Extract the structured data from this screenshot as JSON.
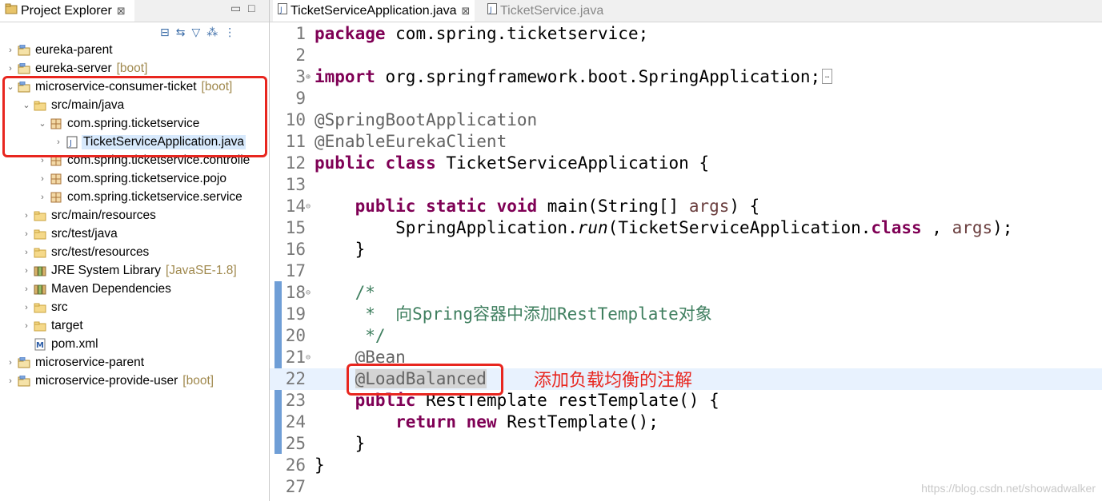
{
  "explorer": {
    "tab_label": "Project Explorer",
    "close_glyph": "⊠",
    "minimize_glyph": "▭",
    "maximize_glyph": "□",
    "toolbar_icons": [
      "collapse-all-icon",
      "link-with-editor-icon",
      "filter-icon",
      "focus-icon",
      "view-menu-icon"
    ],
    "toolbar_glyphs": [
      "⊟",
      "⇆",
      "▽",
      "⁂",
      "⋮"
    ],
    "tree": [
      {
        "indent": 0,
        "twisty": "›",
        "icon": "project-icon",
        "glyph": "📁",
        "label": "eureka-parent",
        "deco": ""
      },
      {
        "indent": 0,
        "twisty": "›",
        "icon": "maven-project-icon",
        "glyph": "📁",
        "label": "eureka-server",
        "deco": "[boot]"
      },
      {
        "indent": 0,
        "twisty": "⌄",
        "icon": "maven-project-icon",
        "glyph": "📁",
        "label": "microservice-consumer-ticket",
        "deco": "[boot]"
      },
      {
        "indent": 1,
        "twisty": "⌄",
        "icon": "source-folder-icon",
        "glyph": "📂",
        "label": "src/main/java",
        "deco": ""
      },
      {
        "indent": 2,
        "twisty": "⌄",
        "icon": "package-icon",
        "glyph": "▦",
        "label": "com.spring.ticketservice",
        "deco": ""
      },
      {
        "indent": 3,
        "twisty": "›",
        "icon": "java-file-icon",
        "glyph": "J",
        "label": "TicketServiceApplication.java",
        "deco": "",
        "selected": true
      },
      {
        "indent": 2,
        "twisty": "›",
        "icon": "package-icon",
        "glyph": "▦",
        "label": "com.spring.ticketservice.controlle",
        "deco": ""
      },
      {
        "indent": 2,
        "twisty": "›",
        "icon": "package-icon",
        "glyph": "▦",
        "label": "com.spring.ticketservice.pojo",
        "deco": ""
      },
      {
        "indent": 2,
        "twisty": "›",
        "icon": "package-icon",
        "glyph": "▦",
        "label": "com.spring.ticketservice.service",
        "deco": ""
      },
      {
        "indent": 1,
        "twisty": "›",
        "icon": "source-folder-icon",
        "glyph": "📂",
        "label": "src/main/resources",
        "deco": ""
      },
      {
        "indent": 1,
        "twisty": "›",
        "icon": "source-folder-icon",
        "glyph": "📂",
        "label": "src/test/java",
        "deco": ""
      },
      {
        "indent": 1,
        "twisty": "›",
        "icon": "source-folder-icon",
        "glyph": "📂",
        "label": "src/test/resources",
        "deco": ""
      },
      {
        "indent": 1,
        "twisty": "›",
        "icon": "library-icon",
        "glyph": "▤",
        "label": "JRE System Library",
        "deco": "[JavaSE-1.8]"
      },
      {
        "indent": 1,
        "twisty": "›",
        "icon": "library-icon",
        "glyph": "▤",
        "label": "Maven Dependencies",
        "deco": ""
      },
      {
        "indent": 1,
        "twisty": "›",
        "icon": "folder-icon",
        "glyph": "📂",
        "label": "src",
        "deco": ""
      },
      {
        "indent": 1,
        "twisty": "›",
        "icon": "folder-icon",
        "glyph": "📂",
        "label": "target",
        "deco": ""
      },
      {
        "indent": 1,
        "twisty": "",
        "icon": "maven-pom-icon",
        "glyph": "M",
        "label": "pom.xml",
        "deco": ""
      },
      {
        "indent": 0,
        "twisty": "›",
        "icon": "project-icon",
        "glyph": "📁",
        "label": "microservice-parent",
        "deco": ""
      },
      {
        "indent": 0,
        "twisty": "›",
        "icon": "maven-project-icon",
        "glyph": "📁",
        "label": "microservice-provide-user",
        "deco": "[boot]"
      }
    ]
  },
  "editor": {
    "tabs": [
      {
        "label": "TicketServiceApplication.java",
        "active": true,
        "close": "⊠"
      },
      {
        "label": "TicketService.java",
        "active": false,
        "close": ""
      }
    ],
    "lines": [
      {
        "n": "1",
        "fold": "",
        "tokens": [
          [
            "kw",
            "package"
          ],
          [
            "",
            "com.spring.ticketservice;"
          ]
        ]
      },
      {
        "n": "2",
        "fold": "",
        "tokens": []
      },
      {
        "n": "3",
        "fold": "⊕",
        "tokens": [
          [
            "kw",
            "import"
          ],
          [
            "",
            "org.springframework.boot.SpringApplication;"
          ],
          [
            "box",
            ""
          ]
        ]
      },
      {
        "n": "9",
        "fold": "",
        "tokens": []
      },
      {
        "n": "10",
        "fold": "",
        "tokens": [
          [
            "ann",
            "@SpringBootApplication"
          ]
        ]
      },
      {
        "n": "11",
        "fold": "",
        "tokens": [
          [
            "ann",
            "@EnableEurekaClient"
          ]
        ]
      },
      {
        "n": "12",
        "fold": "",
        "tokens": [
          [
            "kw",
            "public class"
          ],
          [
            "",
            "TicketServiceApplication {"
          ]
        ]
      },
      {
        "n": "13",
        "fold": "",
        "tokens": []
      },
      {
        "n": "14",
        "fold": "⊖",
        "tokens": [
          [
            "",
            "    "
          ],
          [
            "kw",
            "public static void"
          ],
          [
            "",
            " main(String[] "
          ],
          [
            "param",
            "args"
          ],
          [
            "",
            ") {"
          ]
        ]
      },
      {
        "n": "15",
        "fold": "",
        "tokens": [
          [
            "",
            "        SpringApplication."
          ],
          [
            "it",
            "run"
          ],
          [
            "",
            "(TicketServiceApplication."
          ],
          [
            "kw",
            "class"
          ],
          [
            "",
            ", "
          ],
          [
            "param",
            "args"
          ],
          [
            "",
            ");"
          ]
        ]
      },
      {
        "n": "16",
        "fold": "",
        "tokens": [
          [
            "",
            "    }"
          ]
        ]
      },
      {
        "n": "17",
        "fold": "",
        "tokens": []
      },
      {
        "n": "18",
        "fold": "⊖",
        "tokens": [
          [
            "",
            "    "
          ],
          [
            "cmt",
            "/*"
          ]
        ]
      },
      {
        "n": "19",
        "fold": "",
        "tokens": [
          [
            "",
            "     "
          ],
          [
            "cmt",
            "*  向Spring容器中添加RestTemplate对象"
          ]
        ]
      },
      {
        "n": "20",
        "fold": "",
        "tokens": [
          [
            "",
            "     "
          ],
          [
            "cmt",
            "*/"
          ]
        ]
      },
      {
        "n": "21",
        "fold": "⊖",
        "tokens": [
          [
            "",
            "    "
          ],
          [
            "ann",
            "@Bean"
          ]
        ]
      },
      {
        "n": "22",
        "fold": "",
        "current": true,
        "tokens": [
          [
            "",
            "    "
          ],
          [
            "annhl",
            "@LoadBalanced"
          ]
        ]
      },
      {
        "n": "23",
        "fold": "",
        "tokens": [
          [
            "",
            "    "
          ],
          [
            "kw",
            "public"
          ],
          [
            "",
            " RestTemplate restTemplate() {"
          ]
        ]
      },
      {
        "n": "24",
        "fold": "",
        "tokens": [
          [
            "",
            "        "
          ],
          [
            "kw",
            "return new"
          ],
          [
            "",
            " RestTemplate();"
          ]
        ]
      },
      {
        "n": "25",
        "fold": "",
        "tokens": [
          [
            "",
            "    }"
          ]
        ]
      },
      {
        "n": "26",
        "fold": "",
        "tokens": [
          [
            "",
            "}"
          ]
        ]
      },
      {
        "n": "27",
        "fold": "",
        "tokens": []
      }
    ],
    "annotation_note": "添加负载均衡的注解",
    "watermark": "https://blog.csdn.net/showadwalker"
  },
  "colors": {
    "keyword": "#7f0055",
    "annotation": "#646464",
    "comment": "#3f7f5f",
    "highlight_box": "#e8261f",
    "selection": "#d7e9fc",
    "current_line": "#e8f2fe"
  }
}
